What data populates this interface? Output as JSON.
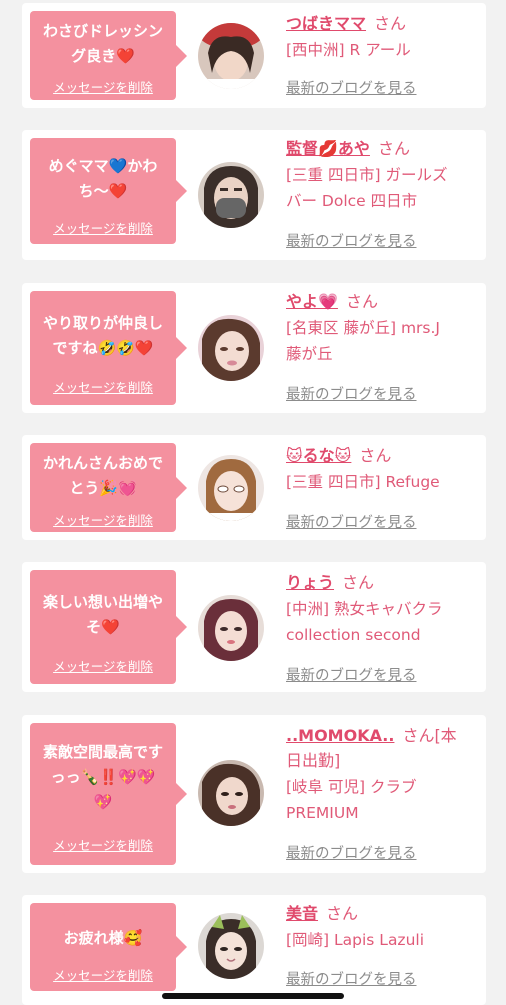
{
  "labels": {
    "delete": "メッセージを削除",
    "latest_blog": "最新のブログを見る"
  },
  "colors": {
    "bubble": "#f4919f",
    "name": "#e04a6c",
    "shop": "#e05a78",
    "link_gray": "#8c8c8c"
  },
  "entries": [
    {
      "message_l1": "わさびドレッシン",
      "message_l2": "グ良き❤️",
      "name": "つばきママ",
      "suffix": "さん",
      "shop_l1": "[西中洲] R アール",
      "shop_l2": ""
    },
    {
      "message_l1": "めぐママ💙かわ",
      "message_l2": "ち〜❤️",
      "name": "監督💋あや",
      "suffix": "さん",
      "shop_l1": "[三重 四日市] ガールズ",
      "shop_l2": "バー Dolce 四日市"
    },
    {
      "message_l1": "やり取りが仲良し",
      "message_l2": "ですね🤣🤣❤️",
      "name": "やよ💗",
      "suffix": "さん",
      "shop_l1": "[名東区 藤が丘] mrs.J",
      "shop_l2": "藤が丘"
    },
    {
      "message_l1": "かれんさんおめで",
      "message_l2": "とう🎉💓",
      "name": "🐱るな🐱",
      "suffix": "さん",
      "shop_l1": "[三重 四日市] Refuge",
      "shop_l2": ""
    },
    {
      "message_l1": "楽しい想い出増や",
      "message_l2": "そ❤️",
      "name": "りょう",
      "suffix": "さん",
      "shop_l1": "[中洲] 熟女キャバクラ",
      "shop_l2": "collection second"
    },
    {
      "message_l1": "素敵空間最高です",
      "message_l2": "っっ🍾‼️💖💖",
      "message_l3": "💖",
      "name": "..MOMOKA..",
      "suffix": "さん[本",
      "name_l2": "日出勤]",
      "shop_l1": "[岐阜 可児] クラブ",
      "shop_l2": "PREMIUM"
    },
    {
      "message_l1": "お疲れ様🥰",
      "message_l2": "",
      "name": "美音",
      "suffix": "さん",
      "shop_l1": "[岡崎] Lapis Lazuli",
      "shop_l2": ""
    }
  ]
}
